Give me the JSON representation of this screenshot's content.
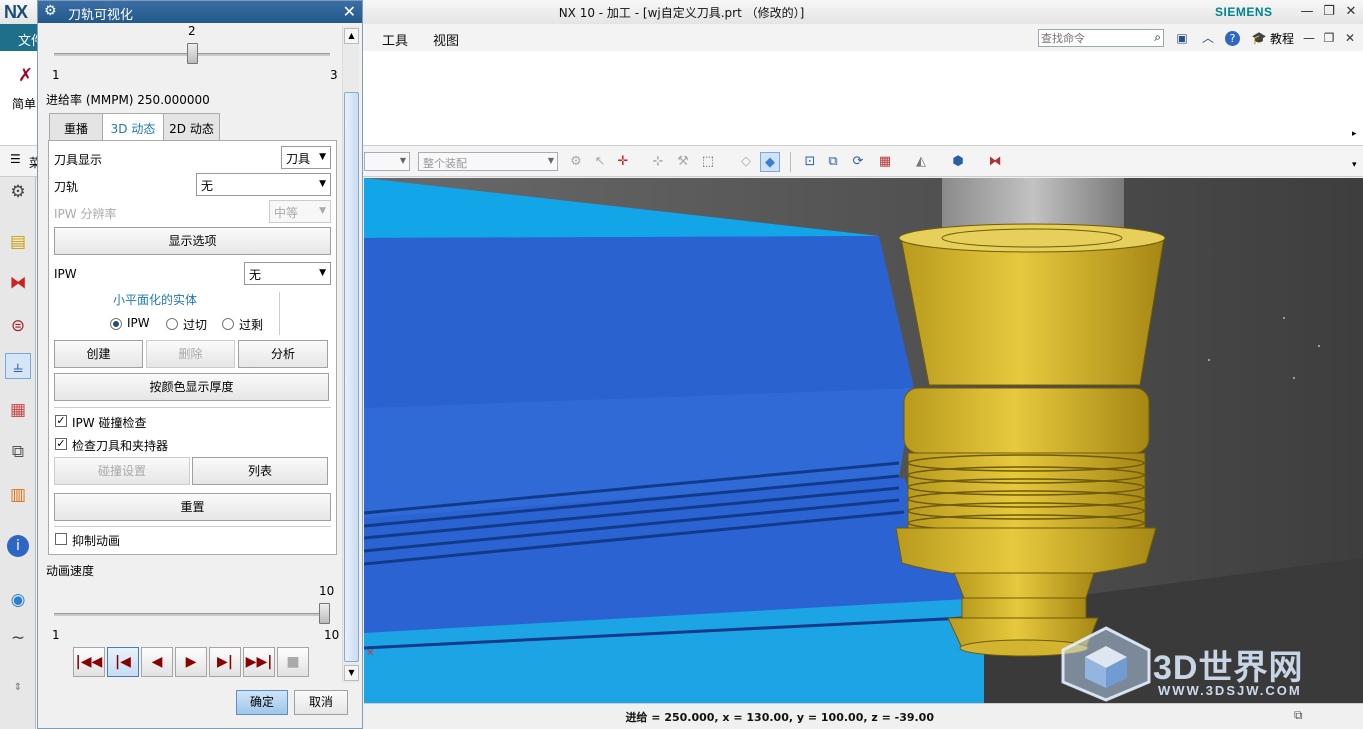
{
  "window": {
    "logo": "NX",
    "title": "NX 10 - 加工 - [wj自定义刀具.prt （修改的）]",
    "brand": "SIEMENS",
    "minimize_icon": "minimize-icon",
    "restore_icon": "restore-icon",
    "close_icon": "close-icon"
  },
  "menubar": {
    "file_tab": "文件",
    "items": [
      "工具",
      "视图"
    ],
    "search_placeholder": "查找命令",
    "tutorial_label": "教程"
  },
  "ribbon": {
    "label": "简单"
  },
  "toolbar": {
    "select_left": "",
    "select_assembly": "整个装配",
    "sidebar_label": "菜"
  },
  "dialog": {
    "title": "刀轨可视化",
    "top_slider": {
      "value": 2,
      "min_label": "1",
      "max_label": "3",
      "value_label": "2"
    },
    "feed_rate": "进给率 (MMPM) 250.000000",
    "tabs": [
      "重播",
      "3D 动态",
      "2D 动态"
    ],
    "active_tab": "3D 动态",
    "tool_display": {
      "label": "刀具显示",
      "value": "刀具"
    },
    "toolpath": {
      "label": "刀轨",
      "value": "无"
    },
    "ipw_resolution": {
      "label": "IPW 分辨率",
      "value": "中等",
      "enabled": false
    },
    "display_options_button": "显示选项",
    "ipw": {
      "label": "IPW",
      "value": "无"
    },
    "faceted_solid": {
      "title": "小平面化的实体",
      "options": [
        "IPW",
        "过切",
        "过剩"
      ],
      "selected": "IPW"
    },
    "create_button": "创建",
    "delete_button": "删除",
    "analyze_button": "分析",
    "thickness_button": "按颜色显示厚度",
    "ipw_collision_check": {
      "label": "IPW 碰撞检查",
      "checked": true
    },
    "check_tool_holder": {
      "label": "检查刀具和夹持器",
      "checked": true
    },
    "collision_settings_button": "碰撞设置",
    "list_button": "列表",
    "reset_button": "重置",
    "suppress_animation": {
      "label": "抑制动画",
      "checked": false
    },
    "animation_speed": {
      "label": "动画速度",
      "value": 10,
      "value_label": "10",
      "min_label": "1",
      "max_label": "10"
    },
    "playback": {
      "buttons": [
        "rewind-to-start",
        "step-back",
        "play-reverse",
        "play-forward",
        "step-forward",
        "fast-forward-to-end",
        "stop"
      ],
      "glyphs": [
        "|◀◀",
        "|◀",
        "◀",
        "▶",
        "▶|",
        "▶▶|",
        "■"
      ]
    },
    "ok_button": "确定",
    "cancel_button": "取消"
  },
  "status": {
    "text": "进给 = 250.000, x = 130.00, y = 100.00, z = -39.00"
  },
  "watermark": {
    "text": "3D世界网",
    "url": "WWW.3DSJW.COM"
  },
  "colors": {
    "dialog_title": "#2b5f95",
    "file_tab": "#1f6f8b",
    "workpiece_blue": "#2f6ad6",
    "workpiece_cyan": "#12a6e8",
    "tool_yellow": "#d9b92c",
    "viewport_bg": "#565656"
  }
}
